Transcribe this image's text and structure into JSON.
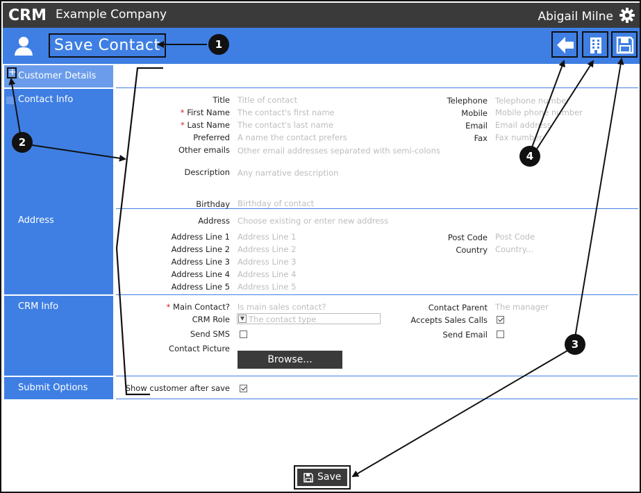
{
  "header": {
    "logo_text": "CRM",
    "company": "Example Company",
    "user": "Abigail Milne",
    "gear_icon": "gear-icon"
  },
  "titlebar": {
    "title": "Save Contact",
    "back_icon": "arrow-left-icon",
    "building_icon": "building-icon",
    "save_icon": "floppy-disk-icon"
  },
  "sidebar": {
    "sections": [
      {
        "label": "Customer Details",
        "toggle": "+"
      },
      {
        "label": "Contact Info"
      },
      {
        "label": "Address"
      },
      {
        "label": "CRM Info"
      },
      {
        "label": "Submit Options"
      }
    ]
  },
  "contact": {
    "title_label": "Title",
    "title_ph": "Title of contact",
    "first_label": "First Name",
    "first_ph": "The contact's first name",
    "last_label": "Last Name",
    "last_ph": "The contact's last name",
    "preferred_label": "Preferred",
    "preferred_ph": "A name the contact prefers",
    "other_label": "Other emails",
    "other_ph": "Other email addresses separated with semi-colons",
    "desc_label": "Description",
    "desc_ph": "Any narrative description",
    "birthday_label": "Birthday",
    "birthday_ph": "Birthday of contact",
    "telephone_label": "Telephone",
    "telephone_ph": "Telephone number",
    "mobile_label": "Mobile",
    "mobile_ph": "Mobile phone number",
    "email_label": "Email",
    "email_ph": "Email address",
    "fax_label": "Fax",
    "fax_ph": "Fax number",
    "required_mark": "*"
  },
  "address": {
    "address_label": "Address",
    "address_ph": "Choose existing or enter new address",
    "line1_label": "Address Line 1",
    "line1_ph": "Address Line 1",
    "line2_label": "Address Line 2",
    "line2_ph": "Address Line 2",
    "line3_label": "Address Line 3",
    "line3_ph": "Address Line 3",
    "line4_label": "Address Line 4",
    "line4_ph": "Address Line 4",
    "line5_label": "Address Line 5",
    "line5_ph": "Address Line 5",
    "postcode_label": "Post Code",
    "postcode_ph": "Post Code",
    "country_label": "Country",
    "country_ph": "Country..."
  },
  "crm": {
    "main_label": "Main Contact?",
    "main_ph": "Is main sales contact?",
    "role_label": "CRM Role",
    "role_ph": "The contact type",
    "sms_label": "Send SMS",
    "picture_label": "Contact Picture",
    "browse_label": "Browse...",
    "parent_label": "Contact Parent",
    "parent_ph": "The manager",
    "calls_label": "Accepts Sales Calls",
    "send_email_label": "Send Email"
  },
  "submit": {
    "show_label": "Show customer after save",
    "save_label": "Save"
  },
  "callouts": [
    "1",
    "2",
    "3",
    "4"
  ]
}
